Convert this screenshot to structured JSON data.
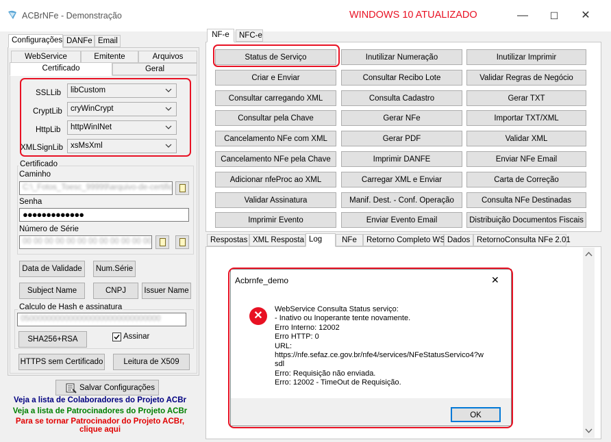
{
  "window": {
    "title": "ACBrNFe - Demonstração",
    "annotation": "WINDOWS 10 ATUALIZADO",
    "min_symbol": "—",
    "max_symbol": "☐",
    "close_symbol": "✕"
  },
  "left": {
    "tabs": [
      "Configurações",
      "DANFe",
      "Email"
    ],
    "subtabs_row1": [
      "WebService",
      "Emitente",
      "Arquivos"
    ],
    "subtabs_row2": [
      "Certificado",
      "Geral"
    ],
    "libs": [
      {
        "label": "SSLLib",
        "value": "libCustom"
      },
      {
        "label": "CryptLib",
        "value": "cryWinCrypt"
      },
      {
        "label": "HttpLib",
        "value": "httpWinINet"
      },
      {
        "label": "XMLSignLib",
        "value": "xsMsXml"
      }
    ],
    "certificado": {
      "group_title": "Certificado",
      "caminho_label": "Caminho",
      "caminho_value": "C:\\_Fotos_Toesc_99999\\arquivo-de-certificado",
      "senha_label": "Senha",
      "senha_value": "●●●●●●●●●●●●●",
      "serie_label": "Número de Série",
      "serie_value": "00 00 00 00 00 00 00 00 00 00 00 00 00 00 00 52C"
    },
    "buttons": {
      "data_validade": "Data de Validade",
      "num_serie": "Num.Série",
      "subject_name": "Subject Name",
      "cnpj": "CNPJ",
      "issuer_name": "Issuer Name"
    },
    "hash": {
      "group_title": "Calculo de Hash e assinatura",
      "value": "05000000000000000000000000000000",
      "sha_button": "SHA256+RSA",
      "assinar_label": "Assinar",
      "assinar_checked": true
    },
    "https_button": "HTTPS sem Certificado",
    "x509_button": "Leitura de X509",
    "salvar_button": "Salvar Configurações",
    "links": [
      {
        "text": "Veja a lista de Colaboradores do Projeto ACBr",
        "color": "#000080"
      },
      {
        "text": "Veja a lista de Patrocinadores do Projeto ACBr",
        "color": "#008000"
      },
      {
        "text": "Para se tornar Patrocinador do Projeto ACBr,",
        "color": "#e00000"
      },
      {
        "text": "clique aqui",
        "color": "#e00000"
      }
    ]
  },
  "right": {
    "tabs": [
      "NF-e",
      "NFC-e"
    ],
    "buttons": [
      [
        "Status de Serviço",
        "Inutilizar Numeração",
        "Inutilizar Imprimir"
      ],
      [
        "Criar e Enviar",
        "Consultar Recibo Lote",
        "Validar Regras de Negócio"
      ],
      [
        "Consultar carregando XML",
        "Consulta Cadastro",
        "Gerar TXT"
      ],
      [
        "Consultar pela Chave",
        "Gerar NFe",
        "Importar TXT/XML"
      ],
      [
        "Cancelamento NFe com XML",
        "Gerar PDF",
        "Validar XML"
      ],
      [
        "Cancelamento NFe pela Chave",
        "Imprimir DANFE",
        "Enviar NFe Email"
      ],
      [
        "Adicionar nfeProc ao XML",
        "Carregar XML e Enviar",
        "Carta de Correção"
      ],
      [
        "Validar Assinatura",
        "Manif. Dest. - Conf. Operação",
        "Consulta NFe Destinadas"
      ],
      [
        "Imprimir Evento",
        "Enviar Evento Email",
        "Distribuição Documentos Fiscais"
      ]
    ],
    "bottom_tabs": [
      "Respostas",
      "XML Resposta",
      "Log",
      "NFe",
      "Retorno Completo WS",
      "Dados",
      "RetornoConsulta NFe 2.01"
    ]
  },
  "dialog": {
    "title": "Acbrnfe_demo",
    "message": "WebService Consulta Status serviço:\n- Inativo ou Inoperante tente novamente.\nErro Interno: 12002\nErro HTTP: 0\nURL:\nhttps://nfe.sefaz.ce.gov.br/nfe4/services/NFeStatusServico4?w\nsdl\nErro: Requisição não enviada.\nErro: 12002 - TimeOut de Requisição.",
    "ok": "OK",
    "close_symbol": "✕",
    "error_icon_symbol": "✕"
  }
}
